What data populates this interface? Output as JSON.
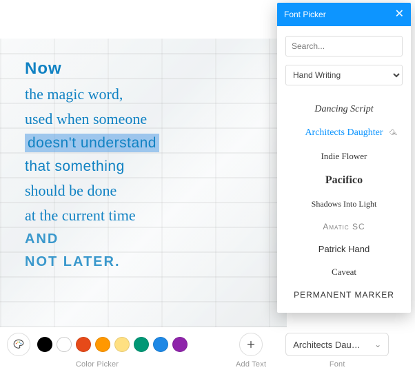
{
  "canvas": {
    "lines": [
      {
        "text": "Now",
        "style": "bold-block"
      },
      {
        "text": "the magic word,",
        "style": "arch"
      },
      {
        "text": "used when someone",
        "style": "arch"
      },
      {
        "text": "doesn't understand",
        "style": "highlight"
      },
      {
        "text": "that something",
        "style": "thin"
      },
      {
        "text": "should be done",
        "style": "arch"
      },
      {
        "text": "at the current time",
        "style": "arch"
      },
      {
        "text": "AND",
        "style": "caps"
      },
      {
        "text": "NOT LATER.",
        "style": "caps"
      }
    ]
  },
  "toolbar": {
    "color_picker_label": "Color Picker",
    "add_text_label": "Add Text",
    "font_label": "Font",
    "font_selected_display": "Architects Dau…",
    "colors": [
      "#000000",
      "#ffffff",
      "#e64a19",
      "#ff9800",
      "#ffe082",
      "#009775",
      "#1e88e5",
      "#8e24aa"
    ]
  },
  "popover": {
    "title": "Font Picker",
    "search_placeholder": "Search...",
    "category_value": "Hand Writing",
    "fonts": [
      {
        "name": "Dancing Script",
        "class": "ff-script",
        "selected": false
      },
      {
        "name": "Architects Daughter",
        "class": "ff-arch",
        "selected": true
      },
      {
        "name": "Indie Flower",
        "class": "ff-indie",
        "selected": false
      },
      {
        "name": "Pacifico",
        "class": "ff-pacifico",
        "selected": false
      },
      {
        "name": "Shadows Into Light",
        "class": "ff-shadows",
        "selected": false
      },
      {
        "name": "Amatic SC",
        "class": "ff-amatic",
        "selected": false
      },
      {
        "name": "Patrick Hand",
        "class": "ff-patrick",
        "selected": false
      },
      {
        "name": "Caveat",
        "class": "ff-caveat",
        "selected": false
      },
      {
        "name": "Permanent Marker",
        "class": "ff-marker",
        "selected": false
      }
    ]
  }
}
